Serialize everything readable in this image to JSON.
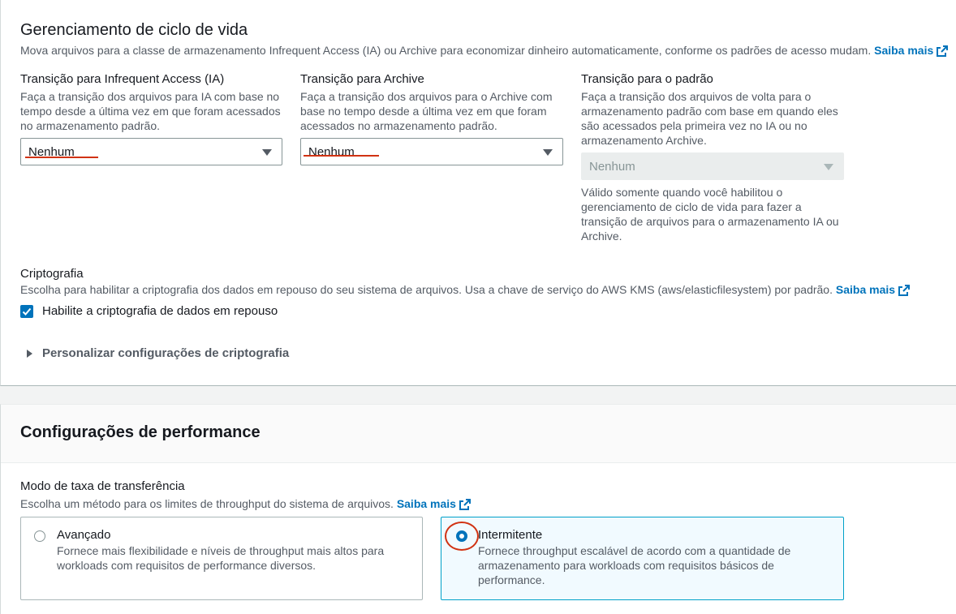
{
  "lifecycle": {
    "title": "Gerenciamento de ciclo de vida",
    "description": "Mova arquivos para a classe de armazenamento Infrequent Access (IA) ou Archive para economizar dinheiro automaticamente, conforme os padrões de acesso mudam.",
    "learn_more": "Saiba mais",
    "ia": {
      "label": "Transição para Infrequent Access (IA)",
      "desc_lines": [
        "Faça a transição dos arquivos para IA com base no",
        "tempo desde a última vez em que foram acessados",
        "no armazenamento padrão."
      ],
      "value": "Nenhum"
    },
    "archive": {
      "label": "Transição para Archive",
      "desc_lines": [
        "Faça a transição dos arquivos para o Archive com",
        "base no tempo desde a última vez em que foram",
        "acessados no armazenamento padrão."
      ],
      "value": "Nenhum"
    },
    "standard": {
      "label": "Transição para o padrão",
      "desc_lines": [
        "Faça a transição dos arquivos de volta para o",
        "armazenamento padrão com base em quando eles",
        "são acessados pela primeira vez no IA ou no",
        "armazenamento Archive."
      ],
      "value": "Nenhum",
      "hint_lines": [
        "Válido somente quando você habilitou o",
        "gerenciamento de ciclo de vida para fazer a",
        "transição de arquivos para o armazenamento IA ou",
        "Archive."
      ]
    }
  },
  "encryption": {
    "title": "Criptografia",
    "description": "Escolha para habilitar a criptografia dos dados em repouso do seu sistema de arquivos. Usa a chave de serviço do AWS KMS (aws/elasticfilesystem) por padrão.",
    "learn_more": "Saiba mais",
    "checkbox_label": "Habilite a criptografia de dados em repouso",
    "checked": true,
    "expand_label": "Personalizar configurações de criptografia"
  },
  "performance": {
    "title": "Configurações de performance",
    "throughput_label": "Modo de taxa de transferência",
    "throughput_desc": "Escolha um método para os limites de throughput do sistema de arquivos.",
    "learn_more": "Saiba mais",
    "options": [
      {
        "title": "Avançado",
        "desc_lines": [
          "Fornece mais flexibilidade e níveis de throughput mais altos para",
          "workloads com requisitos de performance diversos."
        ],
        "selected": false
      },
      {
        "title": "Intermitente",
        "desc_lines": [
          "Fornece throughput escalável de acordo com a quantidade de",
          "armazenamento para workloads com requisitos básicos de",
          "performance."
        ],
        "selected": true
      }
    ]
  },
  "colors": {
    "link": "#0073bb",
    "annotation_red": "#d13212",
    "selected_tile_border": "#00a1c9"
  },
  "icons": [
    "external-link-icon",
    "caret-down-icon",
    "checkmark-icon",
    "expand-caret-icon"
  ]
}
